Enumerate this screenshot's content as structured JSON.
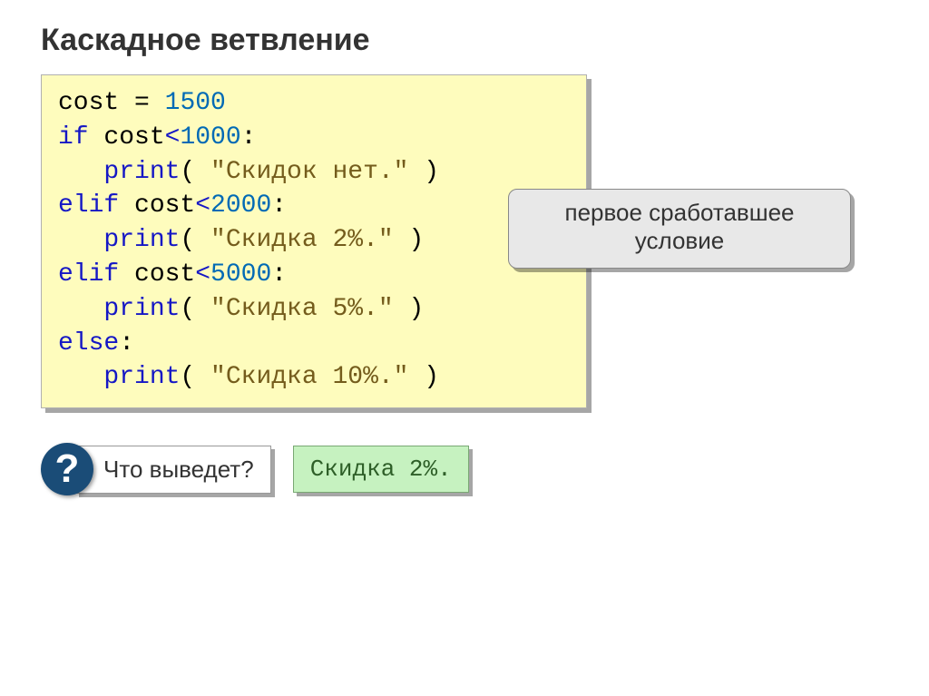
{
  "title": "Каскадное ветвление",
  "code": {
    "l1": {
      "a": "cost ",
      "b": "=",
      "c": " ",
      "d": "1500"
    },
    "l2": {
      "a": "if",
      "b": " cost",
      "c": "<",
      "d": "1000",
      "e": ":"
    },
    "l3": {
      "a": "   print",
      "b": "(",
      "c": " \"Скидок нет.\" ",
      "d": ")"
    },
    "l4": {
      "a": "elif",
      "b": " cost",
      "c": "<",
      "d": "2000",
      "e": ":"
    },
    "l5": {
      "a": "   print",
      "b": "(",
      "c": " \"Скидка 2%.\" ",
      "d": ")"
    },
    "l6": {
      "a": "elif",
      "b": " cost",
      "c": "<",
      "d": "5000",
      "e": ":"
    },
    "l7": {
      "a": "   print",
      "b": "(",
      "c": " \"Скидка 5%.\" ",
      "d": ")"
    },
    "l8": {
      "a": "else",
      "b": ":"
    },
    "l9": {
      "a": "   print",
      "b": "(",
      "c": " \"Скидка 10%.\" ",
      "d": ")"
    }
  },
  "callout": {
    "line1": "первое сработавшее",
    "line2": "условие"
  },
  "question_mark": "?",
  "question_text": "Что выведет?",
  "answer_text": "Скидка 2%."
}
